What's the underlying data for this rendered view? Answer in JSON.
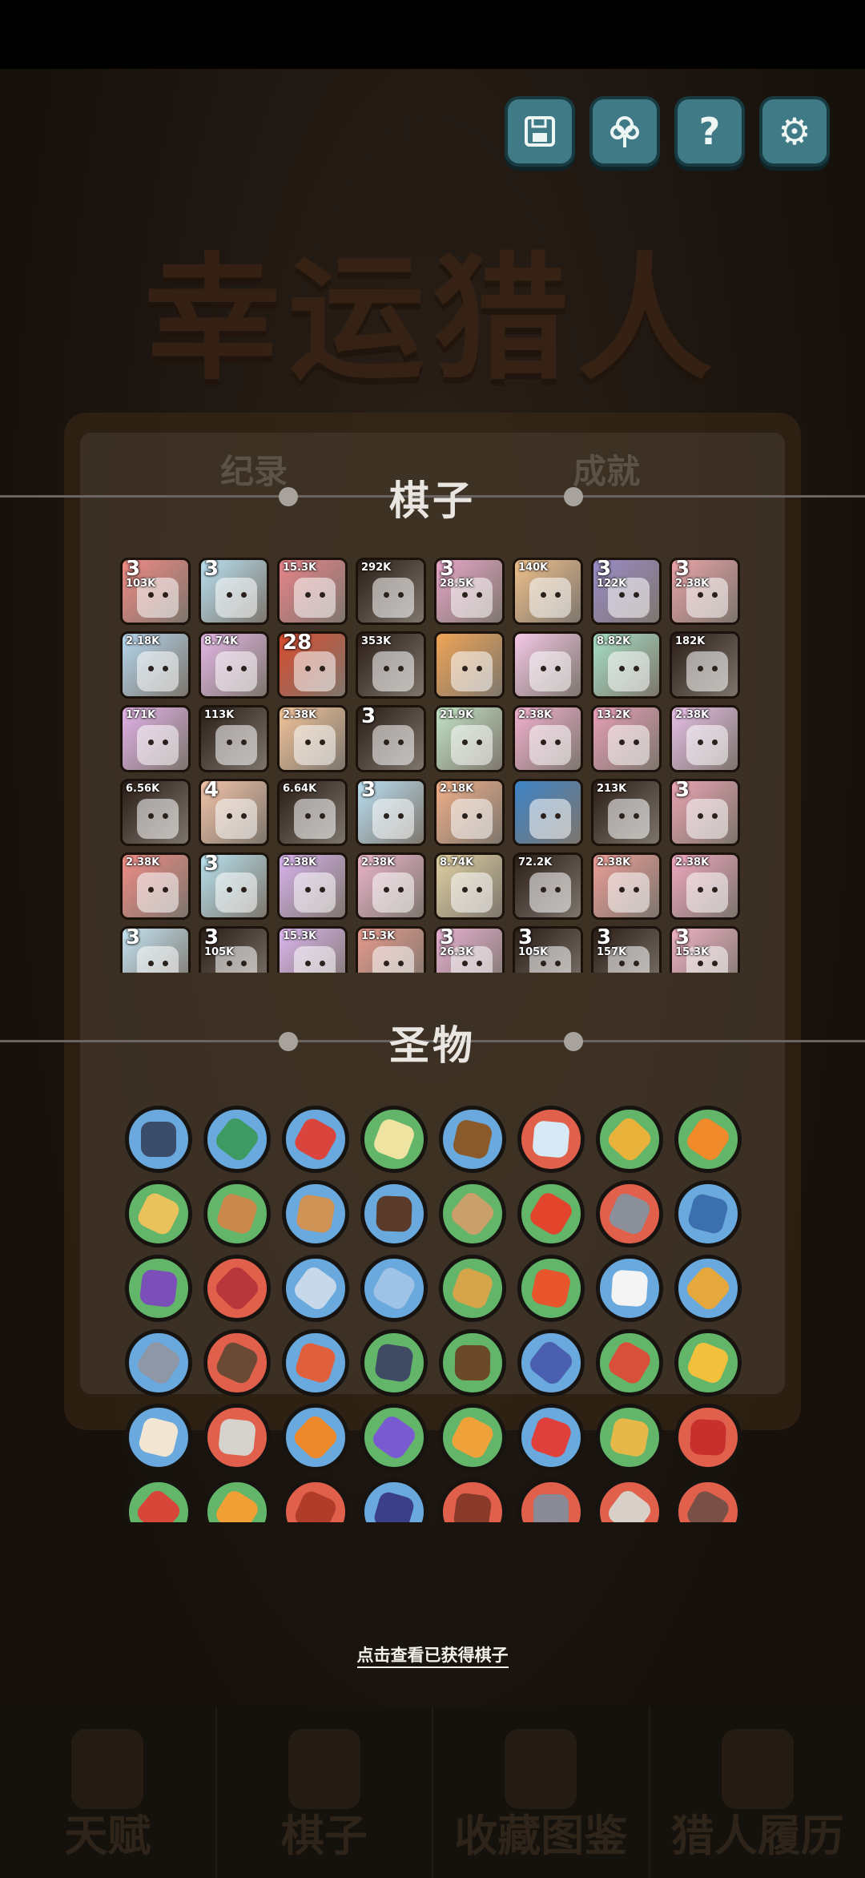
{
  "background": {
    "game_title": "幸运猎人",
    "faded_tabs": [
      "纪录",
      "成就"
    ],
    "nav": [
      {
        "label": "天赋",
        "icon": "arm-icon"
      },
      {
        "label": "棋子",
        "icon": "pieces-icon"
      },
      {
        "label": "收藏图鉴",
        "icon": "book-icon"
      },
      {
        "label": "猎人履历",
        "icon": "history-icon"
      }
    ]
  },
  "top_buttons": [
    {
      "name": "save-button",
      "icon": "floppy-icon",
      "glyph": ""
    },
    {
      "name": "tree-button",
      "icon": "tree-icon",
      "glyph": ""
    },
    {
      "name": "help-button",
      "icon": "question-icon",
      "glyph": "?"
    },
    {
      "name": "settings-button",
      "icon": "gear-icon",
      "glyph": "⚙"
    }
  ],
  "pieces_section": {
    "title": "棋子"
  },
  "pieces": [
    {
      "label": "103K",
      "level": "3",
      "bg": "#f08a84"
    },
    {
      "label": "",
      "level": "3",
      "bg": "#b8e0f0"
    },
    {
      "label": "15.3K",
      "level": "",
      "bg": "#e8848a"
    },
    {
      "label": "292K",
      "level": "",
      "bg": "#2a1d16"
    },
    {
      "label": "28.5K",
      "level": "3",
      "bg": "#e7a6c8"
    },
    {
      "label": "140K",
      "level": "",
      "bg": "#efc08b"
    },
    {
      "label": "122K",
      "level": "3",
      "bg": "#9a8cc8"
    },
    {
      "label": "2.38K",
      "level": "3",
      "bg": "#e9a3a8"
    },
    {
      "label": "2.18K",
      "level": "",
      "bg": "#b5d7ee"
    },
    {
      "label": "8.74K",
      "level": "",
      "bg": "#e5b8e8"
    },
    {
      "label": "",
      "level": "28",
      "bg": "#d94b2d"
    },
    {
      "label": "353K",
      "level": "",
      "bg": "#2a1d16"
    },
    {
      "label": "",
      "level": "",
      "bg": "#f0a455"
    },
    {
      "label": "",
      "level": "",
      "bg": "#f4c8e6"
    },
    {
      "label": "8.82K",
      "level": "",
      "bg": "#a7e0c5"
    },
    {
      "label": "182K",
      "level": "",
      "bg": "#2a1d16"
    },
    {
      "label": "171K",
      "level": "",
      "bg": "#e3b2ea"
    },
    {
      "label": "113K",
      "level": "",
      "bg": "#2a1d16"
    },
    {
      "label": "2.38K",
      "level": "",
      "bg": "#f2c49a"
    },
    {
      "label": "",
      "level": "3",
      "bg": "#2a1d16"
    },
    {
      "label": "21.9K",
      "level": "",
      "bg": "#c1e4c5"
    },
    {
      "label": "2.38K",
      "level": "",
      "bg": "#f3b1d0"
    },
    {
      "label": "13.2K",
      "level": "",
      "bg": "#e8a0b8"
    },
    {
      "label": "2.38K",
      "level": "",
      "bg": "#e7c0e8"
    },
    {
      "label": "6.56K",
      "level": "",
      "bg": "#2a1d16"
    },
    {
      "label": "",
      "level": "4",
      "bg": "#f2c3a8"
    },
    {
      "label": "6.64K",
      "level": "",
      "bg": "#2a1d16"
    },
    {
      "label": "",
      "level": "3",
      "bg": "#b9dff2"
    },
    {
      "label": "2.18K",
      "level": "",
      "bg": "#f0b08a"
    },
    {
      "label": "",
      "level": "",
      "bg": "#3d84c8"
    },
    {
      "label": "213K",
      "level": "",
      "bg": "#2a1d16"
    },
    {
      "label": "",
      "level": "3",
      "bg": "#e9a4b2"
    },
    {
      "label": "2.38K",
      "level": "",
      "bg": "#f08c86"
    },
    {
      "label": "",
      "level": "3",
      "bg": "#b8e2ef"
    },
    {
      "label": "2.38K",
      "level": "",
      "bg": "#d9b4ef"
    },
    {
      "label": "2.38K",
      "level": "",
      "bg": "#ebb5cb"
    },
    {
      "label": "8.74K",
      "level": "",
      "bg": "#e0d1a2"
    },
    {
      "label": "72.2K",
      "level": "",
      "bg": "#2a1d16"
    },
    {
      "label": "2.38K",
      "level": "",
      "bg": "#ec9e98"
    },
    {
      "label": "2.38K",
      "level": "",
      "bg": "#f0a8c0"
    },
    {
      "label": "",
      "level": "3",
      "bg": "#c3e3f1"
    },
    {
      "label": "105K",
      "level": "3",
      "bg": "#2a1d16"
    },
    {
      "label": "15.3K",
      "level": "",
      "bg": "#dcb6ef"
    },
    {
      "label": "15.3K",
      "level": "",
      "bg": "#e69a8c"
    },
    {
      "label": "26.3K",
      "level": "3",
      "bg": "#e6b0d1"
    },
    {
      "label": "105K",
      "level": "3",
      "bg": "#2a1d16"
    },
    {
      "label": "157K",
      "level": "3",
      "bg": "#2a1d16"
    },
    {
      "label": "15.3K",
      "level": "3",
      "bg": "#efb2c4"
    }
  ],
  "relics_section": {
    "title": "圣物"
  },
  "relics": [
    {
      "ring": "#6aa9dd",
      "core": "#3a4c6a"
    },
    {
      "ring": "#6aa9dd",
      "core": "#3d9a63"
    },
    {
      "ring": "#6aa9dd",
      "core": "#d9453c"
    },
    {
      "ring": "#63b56a",
      "core": "#efe3a2"
    },
    {
      "ring": "#6aa9dd",
      "core": "#8b5a2b"
    },
    {
      "ring": "#e0604c",
      "core": "#d7e9f4"
    },
    {
      "ring": "#63b56a",
      "core": "#e8b23b"
    },
    {
      "ring": "#63b56a",
      "core": "#f08a2a"
    },
    {
      "ring": "#63b56a",
      "core": "#e9c25c"
    },
    {
      "ring": "#63b56a",
      "core": "#c9884a"
    },
    {
      "ring": "#6aa9dd",
      "core": "#cf9355"
    },
    {
      "ring": "#6aa9dd",
      "core": "#5a3a28"
    },
    {
      "ring": "#63b56a",
      "core": "#c9a06a"
    },
    {
      "ring": "#63b56a",
      "core": "#e2452c"
    },
    {
      "ring": "#e0604c",
      "core": "#8a8f9a"
    },
    {
      "ring": "#6aa9dd",
      "core": "#3c6fae"
    },
    {
      "ring": "#63b56a",
      "core": "#7a4fb8"
    },
    {
      "ring": "#e0604c",
      "core": "#b8373a"
    },
    {
      "ring": "#6aa9dd",
      "core": "#c6d8ea"
    },
    {
      "ring": "#6aa9dd",
      "core": "#9ec3e6"
    },
    {
      "ring": "#63b56a",
      "core": "#d6a54a"
    },
    {
      "ring": "#63b56a",
      "core": "#e8552c"
    },
    {
      "ring": "#6aa9dd",
      "core": "#f4f4f4"
    },
    {
      "ring": "#6aa9dd",
      "core": "#e5a83c"
    },
    {
      "ring": "#6aa9dd",
      "core": "#8f96a6"
    },
    {
      "ring": "#e0604c",
      "core": "#6b4a35"
    },
    {
      "ring": "#6aa9dd",
      "core": "#e0603e"
    },
    {
      "ring": "#63b56a",
      "core": "#3e4b63"
    },
    {
      "ring": "#63b56a",
      "core": "#6b4a2a"
    },
    {
      "ring": "#6aa9dd",
      "core": "#4b5fb0"
    },
    {
      "ring": "#63b56a",
      "core": "#d8503a"
    },
    {
      "ring": "#63b56a",
      "core": "#f2c03c"
    },
    {
      "ring": "#6aa9dd",
      "core": "#f2e6d2"
    },
    {
      "ring": "#e0604c",
      "core": "#d6d2cc"
    },
    {
      "ring": "#6aa9dd",
      "core": "#ef8a2c"
    },
    {
      "ring": "#63b56a",
      "core": "#7a5ad0"
    },
    {
      "ring": "#63b56a",
      "core": "#f0a23a"
    },
    {
      "ring": "#6aa9dd",
      "core": "#e0403c"
    },
    {
      "ring": "#63b56a",
      "core": "#e6b84a"
    },
    {
      "ring": "#e0604c",
      "core": "#c8302e"
    },
    {
      "ring": "#63b56a",
      "core": "#d8463a"
    },
    {
      "ring": "#63b56a",
      "core": "#f0a034"
    },
    {
      "ring": "#e0604c",
      "core": "#b23c2a"
    },
    {
      "ring": "#6aa9dd",
      "core": "#3a3f88"
    },
    {
      "ring": "#e0604c",
      "core": "#8a3a2a"
    },
    {
      "ring": "#e0604c",
      "core": "#8a8a96"
    },
    {
      "ring": "#e0604c",
      "core": "#d8d0c8"
    },
    {
      "ring": "#e0604c",
      "core": "#7a5046"
    }
  ],
  "footer_link": "点击查看已获得棋子"
}
